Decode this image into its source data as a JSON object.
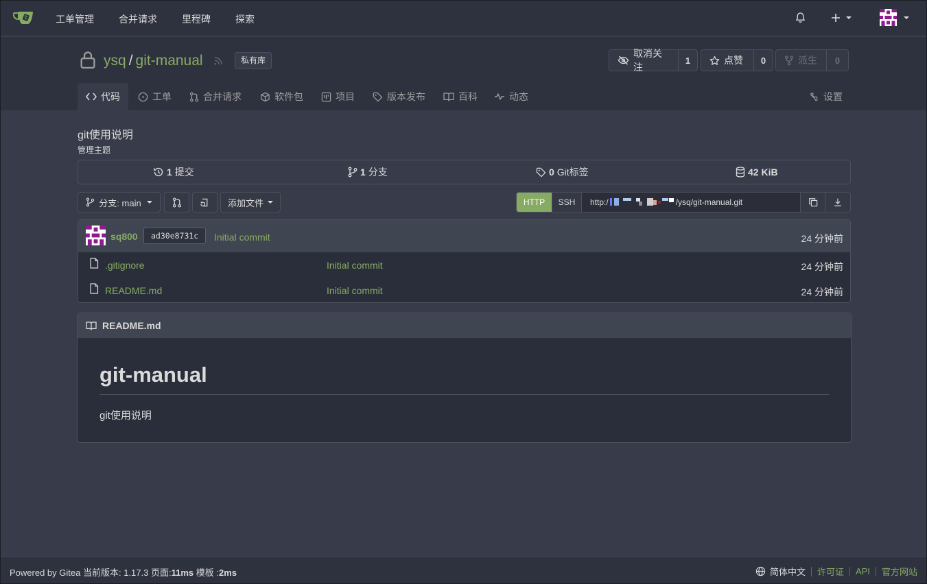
{
  "colors": {
    "accent": "#87ab63",
    "bg": "#383c4a",
    "header_bg": "#2e323e"
  },
  "nav": {
    "items": [
      "工单管理",
      "合并请求",
      "里程碑",
      "探索"
    ]
  },
  "repo": {
    "owner": "ysq",
    "separator": "/",
    "name": "git-manual",
    "private_label": "私有库",
    "watch": {
      "label": "取消关注",
      "count": "1"
    },
    "star": {
      "label": "点赞",
      "count": "0"
    },
    "fork": {
      "label": "派生",
      "count": "0"
    },
    "description": "git使用说明",
    "manage_topics": "管理主题"
  },
  "tabs": [
    {
      "label": "代码",
      "icon": "code-icon"
    },
    {
      "label": "工单",
      "icon": "issue-icon"
    },
    {
      "label": "合并请求",
      "icon": "pull-request-icon"
    },
    {
      "label": "软件包",
      "icon": "package-icon"
    },
    {
      "label": "项目",
      "icon": "project-icon"
    },
    {
      "label": "版本发布",
      "icon": "tag-icon"
    },
    {
      "label": "百科",
      "icon": "book-icon"
    },
    {
      "label": "动态",
      "icon": "pulse-icon"
    },
    {
      "label": "设置",
      "icon": "tools-icon"
    }
  ],
  "stats": {
    "commits": {
      "num": "1",
      "label": "提交"
    },
    "branches": {
      "num": "1",
      "label": "分支"
    },
    "tags": {
      "num": "0",
      "label": "Git标签"
    },
    "size": {
      "num": "42 KiB"
    }
  },
  "toolbar": {
    "branch_label": "分支: main",
    "add_file": "添加文件",
    "http": "HTTP",
    "ssh": "SSH",
    "clone_url_start": "http:/",
    "clone_url_end": "/ysq/git-manual.git"
  },
  "latest_commit": {
    "author": "sq800",
    "sha": "ad30e8731c",
    "message": "Initial commit",
    "time": "24 分钟前"
  },
  "files": [
    {
      "name": ".gitignore",
      "message": "Initial commit",
      "time": "24 分钟前"
    },
    {
      "name": "README.md",
      "message": "Initial commit",
      "time": "24 分钟前"
    }
  ],
  "readme": {
    "filename": "README.md",
    "heading": "git-manual",
    "body": "git使用说明"
  },
  "footer": {
    "powered": "Powered by Gitea",
    "version_label": "当前版本:",
    "version": "1.17.3",
    "page_label": "页面:",
    "page_time": "11ms",
    "template_label": "模板 :",
    "template_time": "2ms",
    "language": "简体中文",
    "license": "许可证",
    "api": "API",
    "website": "官方网站"
  }
}
